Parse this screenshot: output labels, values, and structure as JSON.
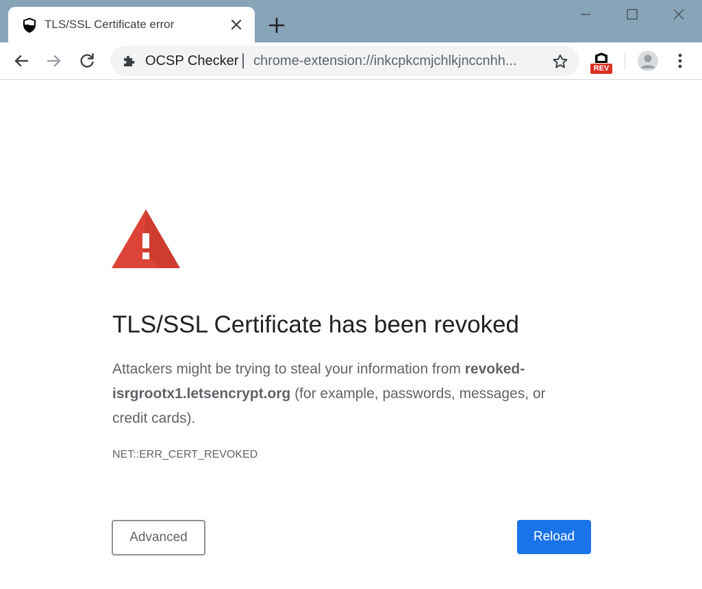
{
  "window": {
    "tab": {
      "title": "TLS/SSL Certificate error",
      "icon": "shield-icon"
    },
    "controls": [
      "minimize-icon",
      "maximize-icon",
      "close-icon"
    ]
  },
  "toolbar": {
    "omnibox": {
      "site_label": "OCSP Checker",
      "url": "chrome-extension://inkcpkcmjchlkjnccnhh..."
    },
    "extension_badge": "REV"
  },
  "page": {
    "heading": "TLS/SSL Certificate has been revoked",
    "body_prefix": "Attackers might be trying to steal your information from ",
    "body_host": "revoked-isrgrootx1.letsencrypt.org",
    "body_suffix": " (for example, passwords, messages, or credit cards).",
    "error_code": "NET::ERR_CERT_REVOKED",
    "advanced_label": "Advanced",
    "reload_label": "Reload"
  },
  "colors": {
    "titlebar": "#87a4b9",
    "warning_red": "#db4437",
    "primary_blue": "#1a73e8"
  }
}
